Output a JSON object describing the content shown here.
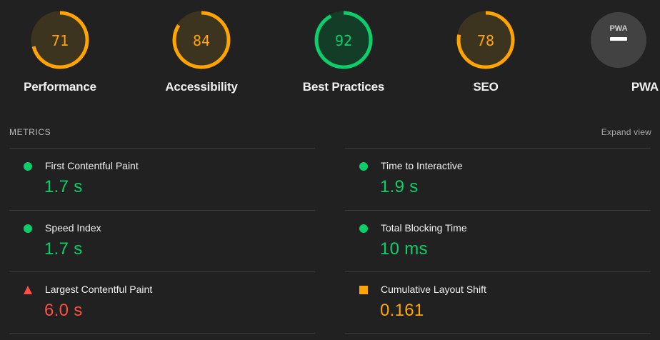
{
  "colors": {
    "pass": "#0cce6b",
    "average": "#ffa400",
    "fail": "#ff4e42",
    "background": "#212121",
    "gauge_track_pass": "#143d27",
    "gauge_track_average": "#3d3420",
    "pwa_circle": "#424242"
  },
  "gauges": [
    {
      "label": "Performance",
      "score": 71,
      "status": "average"
    },
    {
      "label": "Accessibility",
      "score": 84,
      "status": "average"
    },
    {
      "label": "Best Practices",
      "score": 92,
      "status": "pass"
    },
    {
      "label": "SEO",
      "score": 78,
      "status": "average"
    },
    {
      "label": "PWA",
      "badge_text": "PWA",
      "icon": "pwa-dash-icon"
    }
  ],
  "metrics_section": {
    "title": "METRICS",
    "expand_label": "Expand view"
  },
  "metrics": [
    {
      "title": "First Contentful Paint",
      "value": "1.7 s",
      "status": "pass",
      "icon": "green-circle-icon"
    },
    {
      "title": "Time to Interactive",
      "value": "1.9 s",
      "status": "pass",
      "icon": "green-circle-icon"
    },
    {
      "title": "Speed Index",
      "value": "1.7 s",
      "status": "pass",
      "icon": "green-circle-icon"
    },
    {
      "title": "Total Blocking Time",
      "value": "10 ms",
      "status": "pass",
      "icon": "green-circle-icon"
    },
    {
      "title": "Largest Contentful Paint",
      "value": "6.0 s",
      "status": "fail",
      "icon": "red-triangle-icon"
    },
    {
      "title": "Cumulative Layout Shift",
      "value": "0.161",
      "status": "average",
      "icon": "orange-square-icon"
    }
  ]
}
